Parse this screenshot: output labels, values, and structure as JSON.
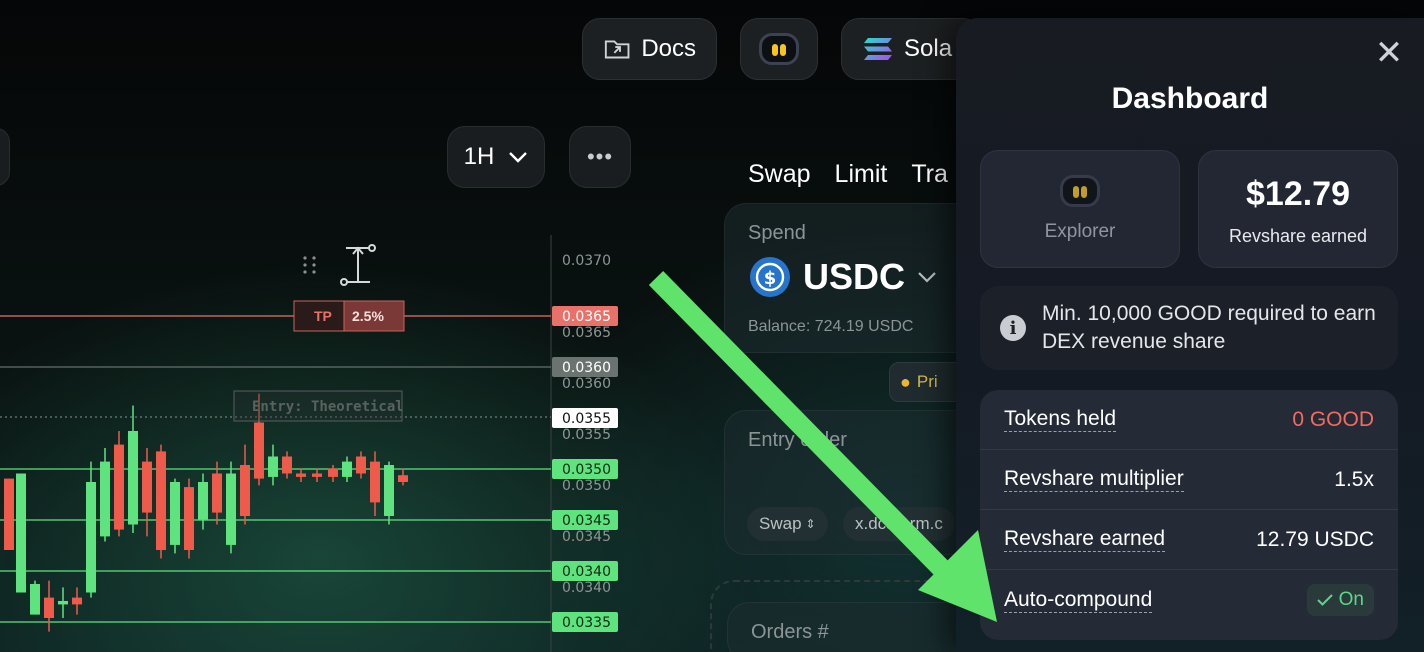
{
  "header": {
    "docs_label": "Docs",
    "network_label": "Sola"
  },
  "chart_controls": {
    "timeframe": "1H",
    "more_label": "•••"
  },
  "chart": {
    "tp_badge": "TP",
    "tp_value": "2.5%",
    "entry_label": "Entry: Theoretical",
    "axis_ticks": [
      "0.0370",
      "0.0365",
      "0.0360",
      "0.0355",
      "0.0350",
      "0.0345",
      "0.0340"
    ],
    "price_tags": [
      "0.0365",
      "0.0360",
      "0.0355",
      "0.0350",
      "0.0345",
      "0.0340",
      "0.0335"
    ],
    "colors": {
      "up": "#5fe37f",
      "down": "#ee5b4b",
      "tp": "#e8726a"
    }
  },
  "swap": {
    "tabs": [
      "Swap",
      "Limit",
      "Tra"
    ],
    "spend_label": "Spend",
    "token": "USDC",
    "balance": "Balance: 724.19 USDC",
    "promo": "Pri",
    "entry_order_label": "Entry order",
    "mode_chip": "Swap",
    "address_chip": "x.dca.arm.c",
    "orders_label": "Orders #"
  },
  "dashboard": {
    "title": "Dashboard",
    "explorer_label": "Explorer",
    "revshare_amount": "$12.79",
    "revshare_caption": "Revshare earned",
    "notice": "Min. 10,000 GOOD required to earn DEX revenue share",
    "rows": [
      {
        "label": "Tokens held",
        "value": "0 GOOD"
      },
      {
        "label": "Revshare multiplier",
        "value": "1.5x"
      },
      {
        "label": "Revshare earned",
        "value": "12.79 USDC"
      },
      {
        "label": "Auto-compound",
        "value": "On"
      }
    ],
    "colors": {
      "warning": "#f26b61",
      "on": "#59d889",
      "arrow": "#5fe36a"
    }
  }
}
